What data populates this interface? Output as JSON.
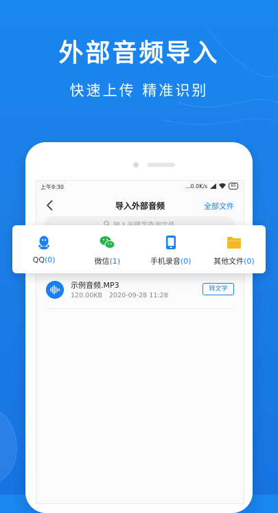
{
  "promo": {
    "headline": "外部音频导入",
    "subline": "快速上传  精准识别"
  },
  "statusbar": {
    "time": "上午9:30",
    "network_speed": "...0.0K/s",
    "battery": "65"
  },
  "nav": {
    "title": "导入外部音频",
    "all_files": "全部文件"
  },
  "search": {
    "placeholder": "输入关键字查询文件"
  },
  "sources": [
    {
      "label": "QQ",
      "count": "(0)",
      "icon": "qq-icon",
      "color": "#1a7ff0"
    },
    {
      "label": "微信",
      "count": "(1)",
      "icon": "wechat-icon",
      "color": "#2bb24c"
    },
    {
      "label": "手机录音",
      "count": "(0)",
      "icon": "phone-recorder-icon",
      "color": "#1a7ff0"
    },
    {
      "label": "其他文件",
      "count": "(0)",
      "icon": "folder-icon",
      "color": "#f5b820"
    }
  ],
  "file": {
    "name": "示例音频.MP3",
    "size": "120.00KB",
    "date": "2020-09-28 11:28",
    "action": "转文字",
    "icon": "audio-wave-icon"
  },
  "colors": {
    "background": "#1a86f0",
    "accent": "#1a7ff0"
  }
}
